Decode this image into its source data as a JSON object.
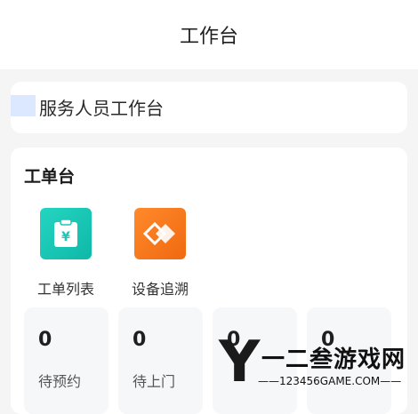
{
  "header": {
    "title": "工作台"
  },
  "role": {
    "label": "服务人员工作台"
  },
  "workorder": {
    "title": "工单台",
    "apps": [
      {
        "label": "工单列表",
        "icon": "yuan-clipboard-icon",
        "color": "#1cc7b5"
      },
      {
        "label": "设备追溯",
        "icon": "trace-diamond-icon",
        "color": "#f57a1e"
      }
    ],
    "stats": [
      {
        "value": "0",
        "label": "待预约"
      },
      {
        "value": "0",
        "label": "待上门"
      },
      {
        "value": "0",
        "label": ""
      },
      {
        "value": "0",
        "label": ""
      }
    ]
  },
  "watermark": {
    "glyph": "Y",
    "text": "一二叁游戏网",
    "url": "——123456GAME.COM——"
  }
}
